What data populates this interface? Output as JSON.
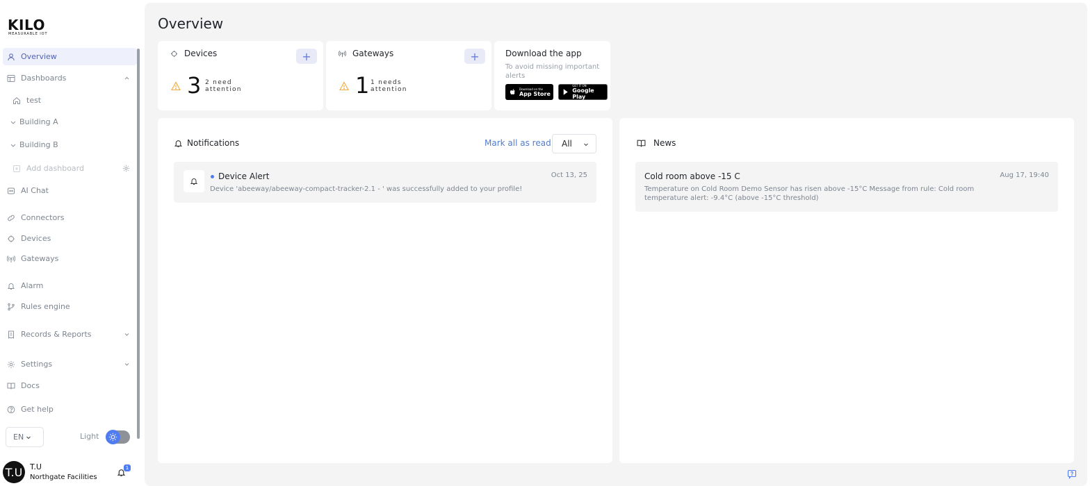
{
  "brand": {
    "name": "KILO",
    "tagline": "MEASURABLE IOT"
  },
  "sidebar": {
    "overview": {
      "label": "Overview",
      "icon": "user-icon",
      "active": true
    },
    "dashboards": {
      "label": "Dashboards",
      "icon": "layout-icon",
      "expanded": true
    },
    "dashboard_items": [
      {
        "label": "test",
        "icon": "home-icon"
      },
      {
        "label": "Building A",
        "icon": "chevron-down-icon"
      },
      {
        "label": "Building B",
        "icon": "chevron-down-icon"
      }
    ],
    "add_dashboard": {
      "label": "Add dashboard",
      "icon": "plus-square-icon"
    },
    "ai_chat": {
      "label": "AI Chat",
      "icon": "bot-icon"
    },
    "connectors": {
      "label": "Connectors",
      "icon": "link-icon"
    },
    "devices": {
      "label": "Devices",
      "icon": "chip-icon"
    },
    "gateways": {
      "label": "Gateways",
      "icon": "antenna-icon"
    },
    "alarm": {
      "label": "Alarm",
      "icon": "bell-icon"
    },
    "rules_engine": {
      "label": "Rules engine",
      "icon": "git-branch-icon"
    },
    "records_reports": {
      "label": "Records & Reports",
      "icon": "receipt-icon"
    },
    "settings": {
      "label": "Settings",
      "icon": "gear-icon"
    },
    "docs": {
      "label": "Docs",
      "icon": "book-icon"
    },
    "get_help": {
      "label": "Get help",
      "icon": "help-circle-icon"
    },
    "language": "EN",
    "theme_label": "Light",
    "user": {
      "initials": "T.U",
      "name": "T.U",
      "organization": "Northgate Facilities",
      "notification_count": "1"
    }
  },
  "main": {
    "title": "Overview",
    "devices_card": {
      "title": "Devices",
      "add_label": "+",
      "count": "3",
      "attention_line1": "2 need",
      "attention_line2": "attention"
    },
    "gateways_card": {
      "title": "Gateways",
      "add_label": "+",
      "count": "1",
      "attention_line1": "1 needs",
      "attention_line2": "attention"
    },
    "app_card": {
      "title": "Download the app",
      "subtitle": "To avoid missing important alerts",
      "app_store": {
        "small": "Download on the",
        "name": "App Store"
      },
      "google_play": {
        "small": "GET IT ON",
        "name": "Google Play"
      }
    },
    "notifications": {
      "title": "Notifications",
      "mark_all_label": "Mark all as read",
      "filter_value": "All",
      "items": [
        {
          "title": "Device Alert",
          "date": "Oct 13, 25",
          "body": "Device 'abeeway/abeeway-compact-tracker-2.1 - ' was successfully added to your profile!",
          "unread": true
        }
      ]
    },
    "news": {
      "title": "News",
      "items": [
        {
          "title": "Cold room above -15 C",
          "date": "Aug 17, 19:40",
          "body": "Temperature on Cold Room Demo Sensor has risen above -15°C Message from rule: Cold room temperature alert: -9.4°C (above -15°C threshold)"
        }
      ]
    }
  },
  "colors": {
    "accent": "#4f7cf0",
    "active_bg": "#eef0fb",
    "warning": "#f0a93a",
    "page_bg": "#f4f4f4"
  }
}
